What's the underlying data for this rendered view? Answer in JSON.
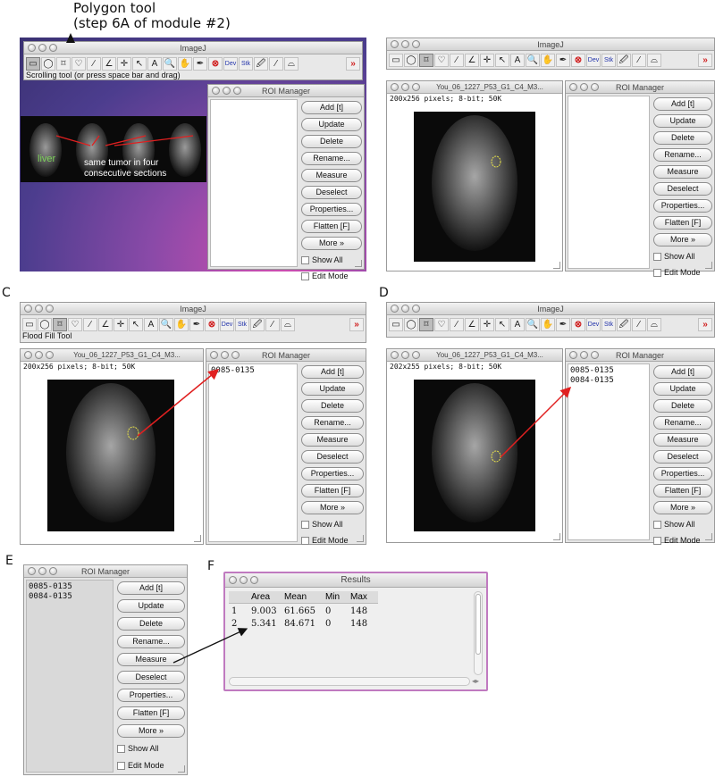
{
  "caption": {
    "line1": "Polygon tool",
    "line2": "(step 6A of module #2)"
  },
  "panel_labels": {
    "c": "C",
    "d": "D",
    "e": "E",
    "f": "F"
  },
  "imagej": {
    "title": "ImageJ",
    "status_a": "Scrolling tool (or press space bar and drag)",
    "status_c": "Flood Fill Tool",
    "tool_glyphs": [
      "▭",
      "◯",
      "⌑",
      "♡",
      "∕",
      "∠",
      "✛",
      "↖",
      "A",
      "🔍",
      "✋",
      "✒",
      "⊗",
      "Dev",
      "Stk",
      "🖉",
      "⁄",
      "⌓",
      "»"
    ]
  },
  "roi_manager": {
    "title": "ROI Manager",
    "buttons": {
      "add": "Add [t]",
      "update": "Update",
      "delete": "Delete",
      "rename": "Rename...",
      "measure": "Measure",
      "deselect": "Deselect",
      "properties": "Properties...",
      "flatten": "Flatten [F]",
      "more": "More »"
    },
    "show_all": "Show All",
    "edit_mode": "Edit Mode",
    "roi1": "0085-0135",
    "roi2": "0084-0135"
  },
  "image_window": {
    "title": "You_06_1227_P53_G1_C4_M3...",
    "info_b": "200x256 pixels; 8-bit; 50K",
    "info_c": "200x256 pixels; 8-bit; 50K",
    "info_d": "202x255 pixels; 8-bit; 50K"
  },
  "annotations": {
    "liver": "liver",
    "tumor_line1": "same tumor in four",
    "tumor_line2": "consecutive sections"
  },
  "results": {
    "title": "Results",
    "headers": [
      "",
      "Area",
      "Mean",
      "Min",
      "Max"
    ],
    "rows": [
      [
        "1",
        "9.003",
        "61.665",
        "0",
        "148"
      ],
      [
        "2",
        "5.341",
        "84.671",
        "0",
        "148"
      ]
    ]
  },
  "colors": {
    "arrow_red": "#e02020",
    "liver_green": "#7dd35a",
    "desktop_purple": "#6a4c9c"
  }
}
